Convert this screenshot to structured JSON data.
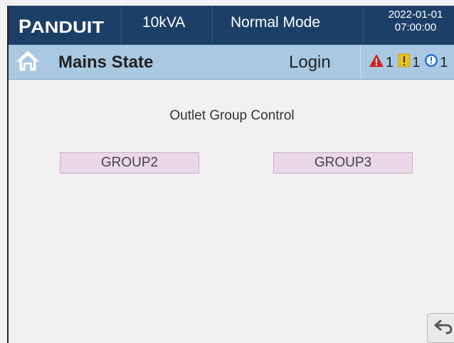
{
  "header": {
    "brand": "PANDUIT",
    "capacity": "10kVA",
    "mode": "Normal Mode",
    "date": "2022-01-01",
    "time": "07:00:00"
  },
  "nav": {
    "home_icon": "home-icon",
    "title": "Mains State",
    "login_label": "Login",
    "alarms": [
      {
        "icon": "warning-triangle-icon",
        "count": "1",
        "color": "#d42020"
      },
      {
        "icon": "caution-square-icon",
        "count": "1",
        "color": "#e8c21a"
      },
      {
        "icon": "info-circle-icon",
        "count": "1",
        "color": "#1f6fe0"
      }
    ]
  },
  "main": {
    "section_title": "Outlet Group Control",
    "groups": [
      {
        "label": "GROUP2"
      },
      {
        "label": "GROUP3"
      }
    ],
    "back_icon": "return-arrow-icon"
  },
  "colors": {
    "topbar": "#1c3f68",
    "navbar": "#a9c9e3",
    "button_fill": "#ead8ea"
  }
}
